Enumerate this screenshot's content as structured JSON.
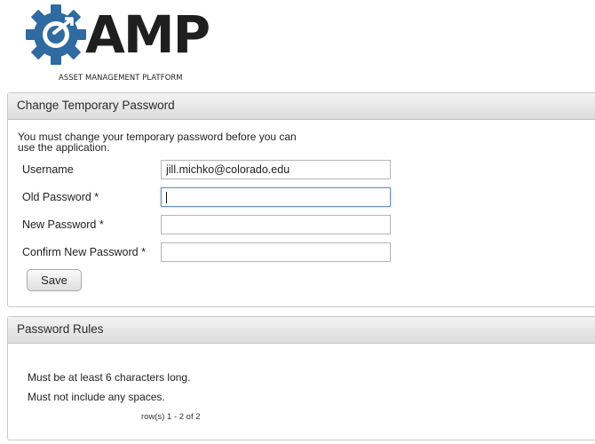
{
  "logo": {
    "word": "AMP",
    "subtitle": "ASSET MANAGEMENT PLATFORM"
  },
  "change_password": {
    "title": "Change Temporary Password",
    "intro": "You must change your temporary password before you can use the application.",
    "fields": [
      {
        "label": "Username",
        "value": "jill.michko@colorado.edu",
        "required": false
      },
      {
        "label": "Old Password *",
        "value": "",
        "required": true,
        "focused": true
      },
      {
        "label": "New Password *",
        "value": "",
        "required": true
      },
      {
        "label": "Confirm New Password *",
        "value": "",
        "required": true
      }
    ],
    "save_label": "Save"
  },
  "password_rules": {
    "title": "Password Rules",
    "rules": [
      "Must be at least 6 characters long.",
      "Must not include any spaces."
    ],
    "pagination": "row(s) 1 - 2 of 2"
  },
  "colors": {
    "logo_gear": "#2f6aa0",
    "logo_text": "#1f1f1f",
    "focus_border": "#6a8fc9"
  }
}
